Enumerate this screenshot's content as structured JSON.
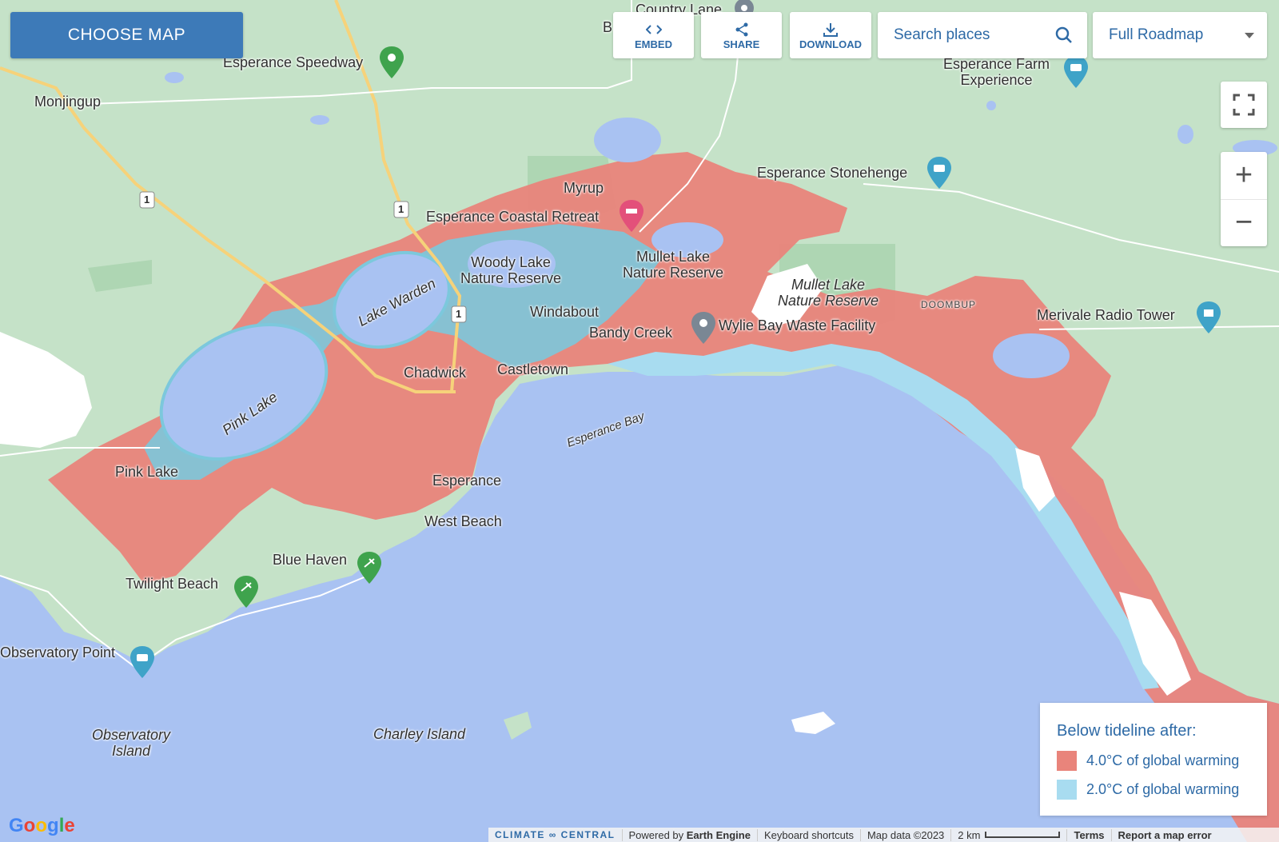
{
  "toolbar": {
    "choose_map": "CHOOSE MAP",
    "embed": "EMBED",
    "share": "SHARE",
    "download": "DOWNLOAD",
    "search_placeholder": "Search places",
    "map_type": "Full Roadmap"
  },
  "controls": {
    "fullscreen_icon": "fullscreen-icon",
    "zoom_in": "+",
    "zoom_out": "−"
  },
  "places": {
    "country_lane": "Country Lane",
    "b_partial": "B",
    "esperance_speedway": "Esperance Speedway",
    "monjingup": "Monjingup",
    "esperance_farm_1": "Esperance Farm",
    "esperance_farm_2": "Experience",
    "myrup": "Myrup",
    "esperance_coastal_retreat": "Esperance Coastal Retreat",
    "esperance_stonehenge": "Esperance Stonehenge",
    "woody_lake_1": "Woody Lake",
    "woody_lake_2": "Nature Reserve",
    "mullet_lake_1": "Mullet Lake",
    "mullet_lake_2": "Nature Reserve",
    "mullet_lake_it_1": "Mullet Lake",
    "mullet_lake_it_2": "Nature Reserve",
    "doombup": "DOOMBUP",
    "merivale": "Merivale Radio Tower",
    "lake_warden": "Lake Warden",
    "windabout": "Windabout",
    "bandy_creek": "Bandy Creek",
    "wylie_bay": "Wylie Bay Waste Facility",
    "chadwick": "Chadwick",
    "castletown": "Castletown",
    "pink_lake_lake": "Pink Lake",
    "pink_lake_town": "Pink Lake",
    "esperance_bay": "Esperance Bay",
    "esperance": "Esperance",
    "west_beach": "West Beach",
    "blue_haven": "Blue Haven",
    "twilight_beach": "Twilight Beach",
    "observatory_point": "Observatory Point",
    "observatory_island_1": "Observatory",
    "observatory_island_2": "Island",
    "charley_island": "Charley Island",
    "route_1": "1"
  },
  "legend": {
    "title": "Below tideline after:",
    "items": [
      {
        "label": "4.0°C of global warming",
        "color": "#e9847b"
      },
      {
        "label": "2.0°C of global warming",
        "color": "#a8dcf0"
      }
    ]
  },
  "footer": {
    "brand": "CLIMATE ∞ CENTRAL",
    "powered_prefix": "Powered by ",
    "powered_name": "Earth Engine",
    "shortcuts": "Keyboard shortcuts",
    "map_data": "Map data ©2023",
    "scale": "2 km",
    "terms": "Terms",
    "report": "Report a map error"
  },
  "google_logo": "Google",
  "colors": {
    "land": "#c5e2c8",
    "sea": "#a9c2f2",
    "flood_4c": "#e9847b",
    "flood_2c": "#7cc8dc",
    "accent": "#3d7ab8"
  }
}
